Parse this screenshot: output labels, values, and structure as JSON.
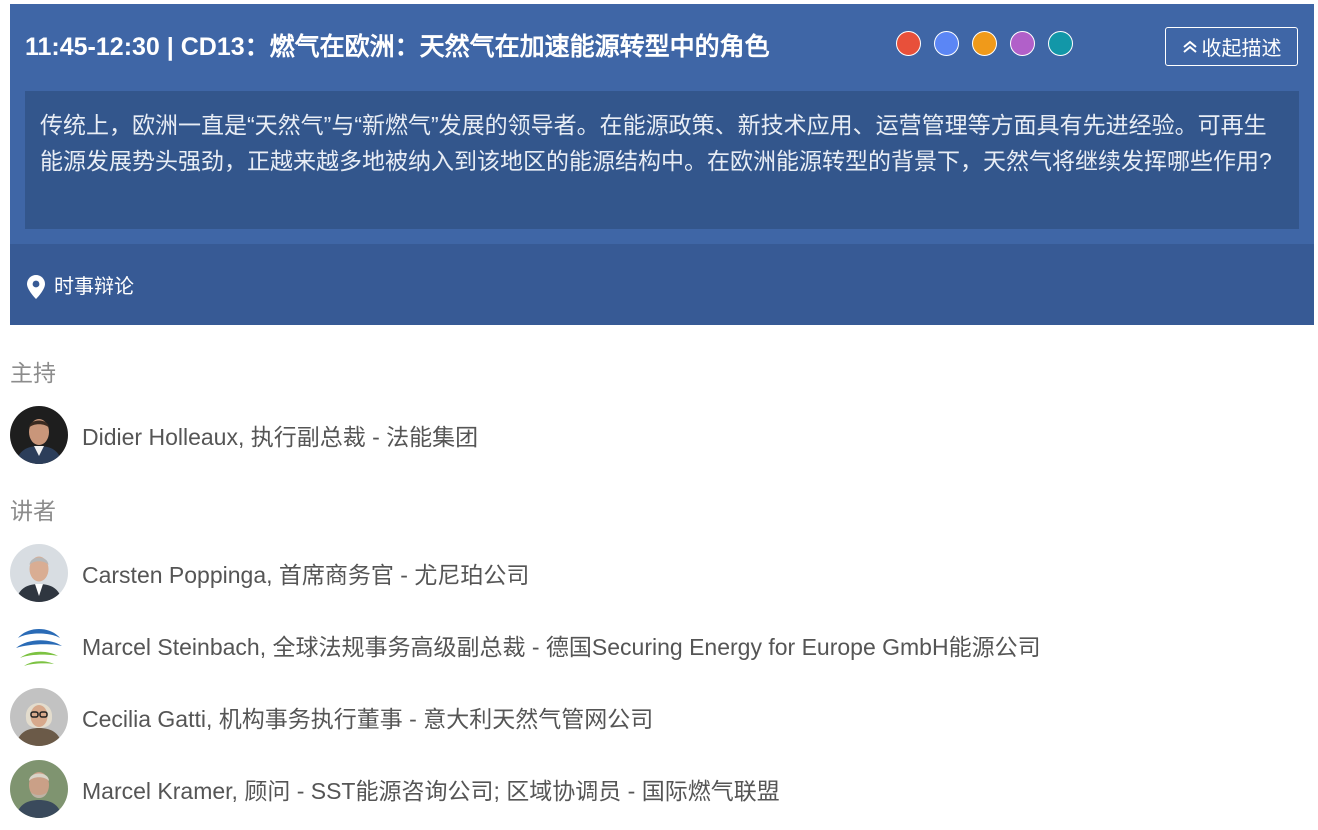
{
  "session": {
    "title": "11:45-12:30 | CD13：燃气在欧洲：天然气在加速能源转型中的角色",
    "track_colors": [
      "#e8503a",
      "#5b86f5",
      "#f09a1a",
      "#b160c9",
      "#1297a8"
    ],
    "collapse_label": "收起描述",
    "description": "传统上，欧洲一直是“天然气”与“新燃气”发展的领导者。在能源政策、新技术应用、运营管理等方面具有先进经验。可再生能源发展势头强劲，正越来越多地被纳入到该地区的能源结构中。在欧洲能源转型的背景下，天然气将继续发挥哪些作用?",
    "location": "时事辩论"
  },
  "moderator_section": {
    "heading": "主持",
    "people": [
      {
        "text": "Didier Holleaux, 执行副总裁 - 法能集团"
      }
    ]
  },
  "speaker_section": {
    "heading": "讲者",
    "people": [
      {
        "text": "Carsten Poppinga, 首席商务官 - 尤尼珀公司"
      },
      {
        "text": "Marcel Steinbach, 全球法规事务高级副总裁 - 德国Securing Energy for Europe GmbH能源公司"
      },
      {
        "text": "Cecilia Gatti, 机构事务执行董事 - 意大利天然气管网公司"
      },
      {
        "text": "Marcel Kramer, 顾问 - SST能源咨询公司; 区域协调员 - 国际燃气联盟"
      }
    ]
  }
}
